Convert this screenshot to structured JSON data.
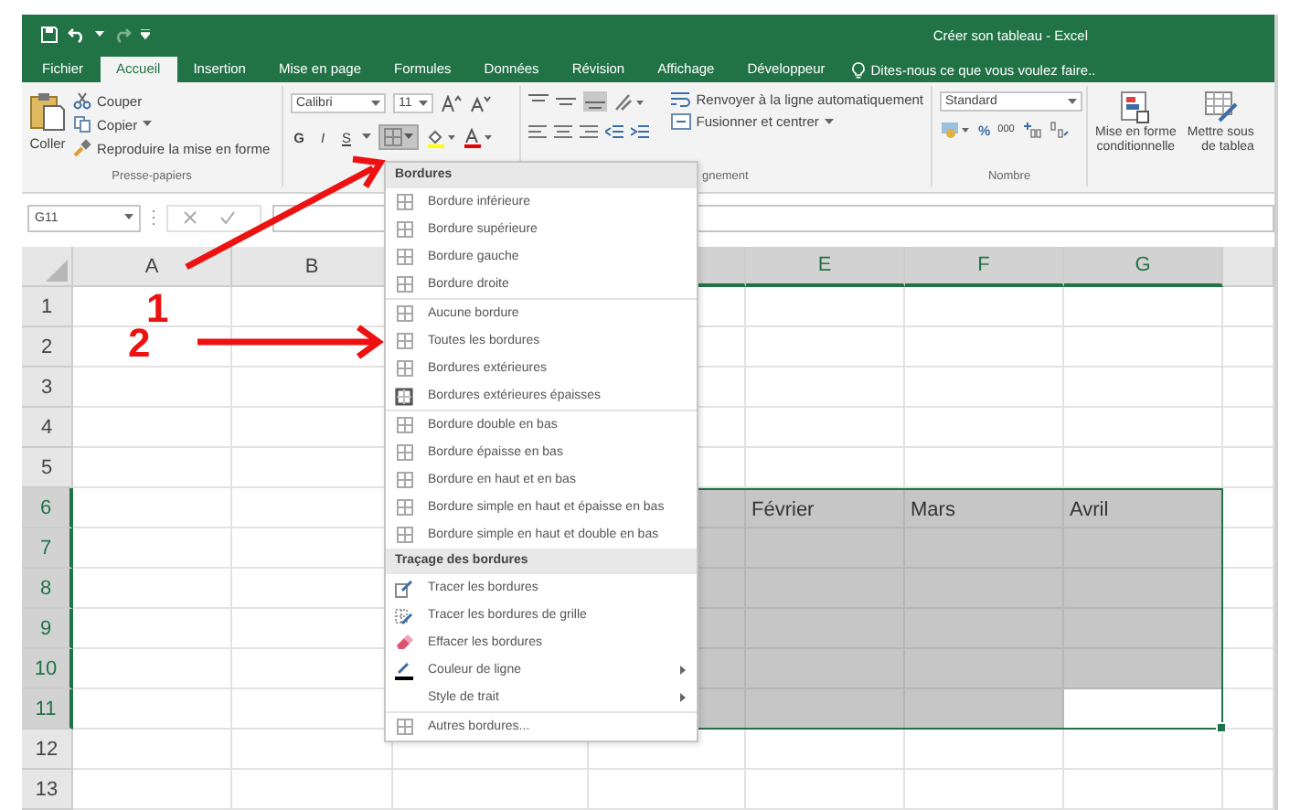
{
  "window": {
    "title": "Créer son tableau - Excel"
  },
  "tabs": [
    {
      "label": "Fichier",
      "selected": false
    },
    {
      "label": "Accueil",
      "selected": true
    },
    {
      "label": "Insertion",
      "selected": false
    },
    {
      "label": "Mise en page",
      "selected": false
    },
    {
      "label": "Formules",
      "selected": false
    },
    {
      "label": "Données",
      "selected": false
    },
    {
      "label": "Révision",
      "selected": false
    },
    {
      "label": "Affichage",
      "selected": false
    },
    {
      "label": "Développeur",
      "selected": false
    }
  ],
  "tell_me": {
    "placeholder": "Dites-nous ce que vous voulez faire.."
  },
  "ribbon": {
    "clipboard": {
      "paste": "Coller",
      "cut": "Couper",
      "copy": "Copier",
      "format_painter": "Reproduire la mise en forme",
      "label": "Presse-papiers"
    },
    "font": {
      "name": "Calibri",
      "size": "11",
      "bold": "G",
      "italic": "I",
      "underline": "S",
      "borders_pressed": true
    },
    "alignment": {
      "wrap": "Renvoyer à la ligne automatiquement",
      "merge": "Fusionner et centrer",
      "label": "gnement"
    },
    "number": {
      "format": "Standard",
      "percent": "%",
      "thousands": "000",
      "label": "Nombre"
    },
    "styles": {
      "conditional": [
        "Mise en forme",
        "conditionnelle"
      ],
      "table": [
        "Mettre sous",
        "de tablea"
      ]
    }
  },
  "formula_bar": {
    "name_box": "G11"
  },
  "sheet": {
    "columns": [
      {
        "label": "A"
      },
      {
        "label": "B"
      },
      {},
      {},
      {
        "label": "E"
      },
      {
        "label": "F"
      },
      {
        "label": "G"
      }
    ],
    "rows": [
      {
        "label": "1",
        "cells": [
          {
            "selected": false
          },
          {
            "selected": false
          },
          {},
          {
            "selected": false
          },
          {
            "selected": false
          },
          {
            "selected": false
          },
          {
            "selected": false
          }
        ]
      },
      {
        "label": "2",
        "cells": [
          {
            "selected": false
          },
          {
            "selected": false
          },
          {},
          {
            "selected": false
          },
          {
            "selected": false
          },
          {
            "selected": false
          },
          {
            "selected": false
          }
        ]
      },
      {
        "label": "3",
        "cells": [
          {
            "selected": false
          },
          {
            "selected": false
          },
          {},
          {
            "selected": false
          },
          {
            "selected": false
          },
          {
            "selected": false
          },
          {
            "selected": false
          }
        ]
      },
      {
        "label": "4",
        "cells": [
          {
            "selected": false
          },
          {
            "selected": false
          },
          {},
          {
            "selected": false
          },
          {
            "selected": false
          },
          {
            "selected": false
          },
          {
            "selected": false
          }
        ]
      },
      {
        "label": "5",
        "cells": [
          {
            "selected": false
          },
          {
            "selected": false
          },
          {},
          {
            "selected": false
          },
          {
            "selected": false
          },
          {
            "selected": false
          },
          {
            "selected": false
          }
        ]
      },
      {
        "label": "6",
        "cells": [
          {
            "selected": false
          },
          {
            "selected": false
          },
          {},
          {
            "selected": true
          },
          {
            "selected": true,
            "text": "Février"
          },
          {
            "selected": true,
            "text": "Mars"
          },
          {
            "selected": true,
            "text": "Avril"
          }
        ]
      },
      {
        "label": "7",
        "cells": [
          {
            "selected": false
          },
          {
            "selected": false
          },
          {},
          {
            "selected": true
          },
          {
            "selected": true
          },
          {
            "selected": true
          },
          {
            "selected": true
          }
        ]
      },
      {
        "label": "8",
        "cells": [
          {
            "selected": false
          },
          {
            "selected": false
          },
          {},
          {
            "selected": true
          },
          {
            "selected": true
          },
          {
            "selected": true
          },
          {
            "selected": true
          }
        ]
      },
      {
        "label": "9",
        "cells": [
          {
            "selected": false
          },
          {
            "selected": false
          },
          {},
          {
            "selected": true
          },
          {
            "selected": true
          },
          {
            "selected": true
          },
          {
            "selected": true
          }
        ]
      },
      {
        "label": "10",
        "cells": [
          {
            "selected": false
          },
          {
            "selected": false
          },
          {},
          {
            "selected": true
          },
          {
            "selected": true
          },
          {
            "selected": true
          },
          {
            "selected": true
          }
        ]
      },
      {
        "label": "11",
        "cells": [
          {
            "selected": false
          },
          {
            "selected": false
          },
          {},
          {
            "selected": true
          },
          {
            "selected": true
          },
          {
            "selected": true
          },
          {
            "selected": true,
            "active": true
          }
        ]
      },
      {
        "label": "12",
        "cells": [
          {
            "selected": false
          },
          {
            "selected": false
          },
          {
            "selected": false
          },
          {
            "selected": false
          },
          {
            "selected": false
          },
          {
            "selected": false
          },
          {
            "selected": false
          }
        ]
      },
      {
        "label": "13",
        "cells": [
          {
            "selected": false
          },
          {
            "selected": false
          },
          {
            "selected": false
          },
          {
            "selected": false
          },
          {
            "selected": false
          },
          {
            "selected": false
          },
          {
            "selected": false
          }
        ]
      }
    ]
  },
  "borders_menu": {
    "sections": [
      {
        "header": "Bordures",
        "groups": [
          [
            {
              "label": "Bordure inférieure",
              "kind": "border"
            },
            {
              "label": "Bordure supérieure",
              "kind": "border"
            },
            {
              "label": "Bordure gauche",
              "kind": "border"
            },
            {
              "label": "Bordure droite",
              "kind": "border"
            }
          ],
          [
            {
              "label": "Aucune bordure",
              "kind": "border"
            },
            {
              "label": "Toutes les bordures",
              "kind": "border"
            },
            {
              "label": "Bordures extérieures",
              "kind": "border"
            },
            {
              "label": "Bordures extérieures épaisses",
              "kind": "border-thick"
            }
          ],
          [
            {
              "label": "Bordure double en bas",
              "kind": "border"
            },
            {
              "label": "Bordure épaisse en bas",
              "kind": "border"
            },
            {
              "label": "Bordure en haut et en bas",
              "kind": "border"
            },
            {
              "label": "Bordure simple en haut et épaisse en bas",
              "kind": "border"
            },
            {
              "label": "Bordure simple en haut et double en bas",
              "kind": "border"
            }
          ]
        ]
      },
      {
        "header": "Traçage des bordures",
        "groups": [
          [
            {
              "label": "Tracer les bordures",
              "kind": "pen"
            },
            {
              "label": "Tracer les bordures de grille",
              "kind": "grid-pen"
            },
            {
              "label": "Effacer les bordures",
              "kind": "eraser"
            },
            {
              "label": "Couleur de ligne",
              "kind": "line-color",
              "submenu": true
            },
            {
              "label": "Style de trait",
              "kind": "plain",
              "submenu": true
            }
          ],
          [
            {
              "label": "Autres bordures...",
              "kind": "border"
            }
          ]
        ]
      }
    ]
  },
  "annotations": [
    {
      "label": "1"
    },
    {
      "label": "2"
    }
  ]
}
